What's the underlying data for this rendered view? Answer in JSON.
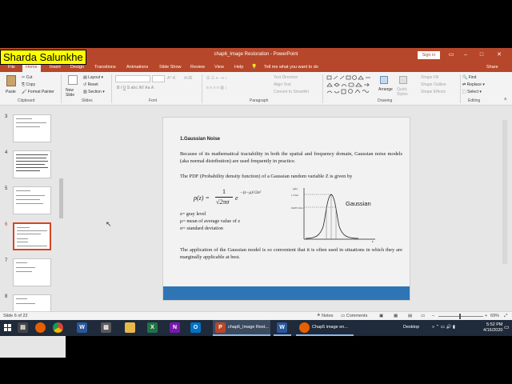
{
  "presenter_name": "Sharda Salunkhe",
  "window": {
    "title": "chap6_Image Restoration  -  PowerPoint",
    "sign_in": "Sign in",
    "share": "Share"
  },
  "tabs": [
    "File",
    "Home",
    "Insert",
    "Design",
    "Transitions",
    "Animations",
    "Slide Show",
    "Review",
    "View",
    "Help",
    "Tell me what you want to do"
  ],
  "active_tab": "Home",
  "ribbon": {
    "clipboard": {
      "paste": "Paste",
      "cut": "Cut",
      "copy": "Copy",
      "format_painter": "Format Painter",
      "group": "Clipboard"
    },
    "slides": {
      "new_slide": "New Slide",
      "layout": "Layout",
      "reset": "Reset",
      "section": "Section",
      "group": "Slides"
    },
    "font": {
      "group": "Font"
    },
    "paragraph": {
      "text_direction": "Text Direction",
      "align_text": "Align Text",
      "smartart": "Convert to SmartArt",
      "group": "Paragraph"
    },
    "drawing": {
      "arrange": "Arrange",
      "quick_styles": "Quick Styles",
      "shape_fill": "Shape Fill",
      "shape_outline": "Shape Outline",
      "shape_effects": "Shape Effects",
      "group": "Drawing"
    },
    "editing": {
      "find": "Find",
      "replace": "Replace",
      "select": "Select",
      "group": "Editing"
    }
  },
  "thumbnails": [
    {
      "num": "3",
      "selected": false
    },
    {
      "num": "4",
      "selected": false
    },
    {
      "num": "5",
      "selected": false
    },
    {
      "num": "6",
      "selected": true
    },
    {
      "num": "7",
      "selected": false
    },
    {
      "num": "8",
      "selected": false
    }
  ],
  "slide": {
    "heading": "1.Gaussian Noise",
    "para1": "Because of its mathematical tractability in both the spatial and frequency domain, Gaussian noise models (aka normal distribution) are used frequently in practice.",
    "para2": "The PDF (Probability density function) of a Gaussian random variable  Z is given by",
    "formula_lhs": "p(z) =",
    "formula_num": "1",
    "formula_den": "√2πσ",
    "formula_exp": "−(z−μ)²/2σ²",
    "def_z": "z= gray level",
    "def_mu": "μ= mean of average value of z",
    "def_sigma": "σ= standard deviation",
    "graph_label": "Gaussian",
    "graph_y_top": "p(z)",
    "graph_y_peak": "1/√2πσ",
    "graph_y_mid": "0.607/√2πσ",
    "graph_x_label": "z",
    "para3": "The application of the Gaussian model is so convenient that it is often used in situations in which they are marginally applicable at best."
  },
  "status": {
    "slide_counter": "Slide 6 of 22",
    "notes": "Notes",
    "comments": "Comments",
    "zoom": "69%"
  },
  "taskbar": {
    "ppt_label": "chap6_Image Rest...",
    "chrome_label": "Chap5 image en...",
    "desktop": "Desktop",
    "time": "5:52 PM",
    "date": "4/16/2020"
  }
}
